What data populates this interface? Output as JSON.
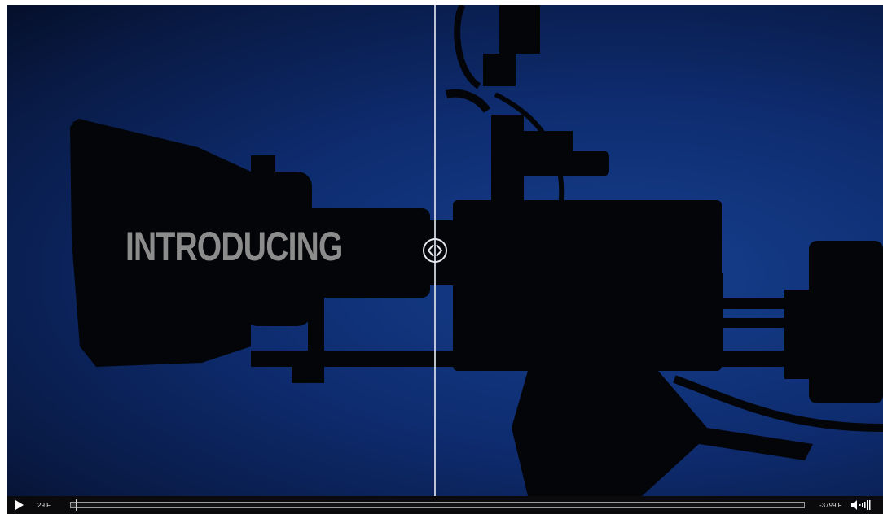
{
  "video": {
    "headline": "INTRODUCING",
    "background_color": "#0e2c70",
    "silhouette_color": "#040508"
  },
  "comparison_slider": {
    "handle_icon": "left-right-arrows-icon"
  },
  "controls": {
    "play_icon": "play-icon",
    "current_frame": "29 F",
    "remaining_frames": "-3799 F",
    "volume_icon": "volume-icon",
    "progress_fraction": 0.007
  }
}
